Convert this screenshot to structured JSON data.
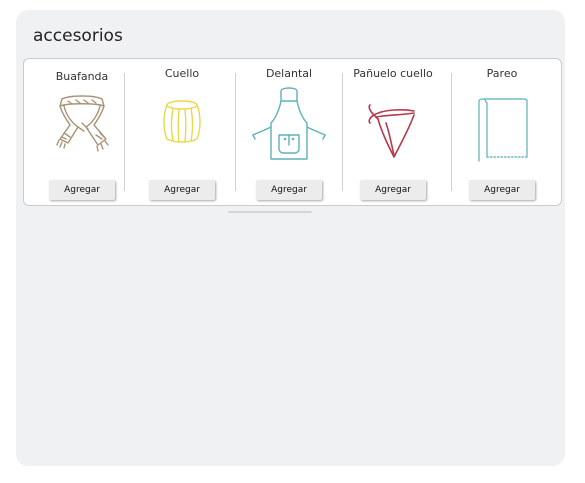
{
  "panel": {
    "title": "accesorios"
  },
  "accessories": [
    {
      "name": "Buafanda",
      "icon": "scarf-icon",
      "button_label": "Agregar"
    },
    {
      "name": "Cuello",
      "icon": "neck-gaiter-icon",
      "button_label": "Agregar"
    },
    {
      "name": "Delantal",
      "icon": "apron-icon",
      "button_label": "Agregar"
    },
    {
      "name": "Pañuelo cuello",
      "icon": "neckerchief-icon",
      "button_label": "Agregar"
    },
    {
      "name": "Pareo",
      "icon": "sarong-icon",
      "button_label": "Agregar"
    }
  ],
  "colors": {
    "panel_bg": "#f0f1f3",
    "scarf": "#a99277",
    "neck": "#e8d84a",
    "apron": "#5fb1b7",
    "neckerchief": "#b8394a",
    "sarong": "#72bcc2"
  }
}
